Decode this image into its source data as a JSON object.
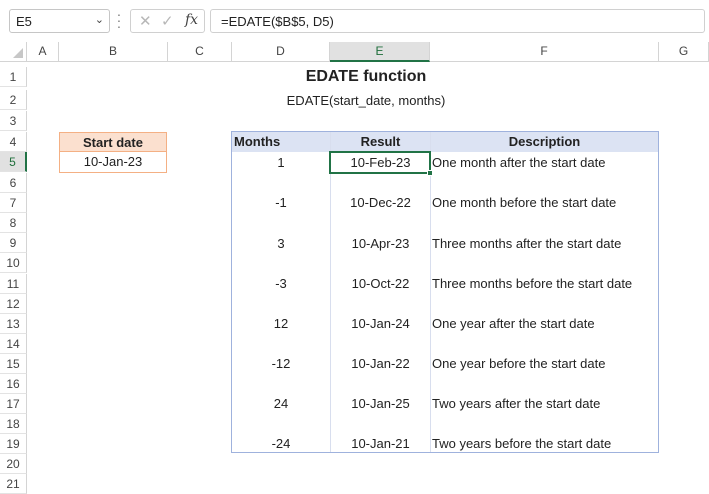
{
  "formula_bar": {
    "name_box": "E5",
    "formula": "=EDATE($B$5, D5)",
    "cancel_symbol": "✕",
    "enter_symbol": "✓",
    "fx_symbol": "fx"
  },
  "columns": [
    "A",
    "B",
    "C",
    "D",
    "E",
    "F",
    "G"
  ],
  "selected_column": "E",
  "rows": [
    "1",
    "2",
    "3",
    "4",
    "5",
    "6",
    "7",
    "8",
    "9",
    "10",
    "11",
    "12",
    "13",
    "14",
    "15",
    "16",
    "17",
    "18",
    "19",
    "20",
    "21"
  ],
  "selected_row": "5",
  "sheet": {
    "title": "EDATE function",
    "subtitle": "EDATE(start_date, months)",
    "start_date_label": "Start date",
    "start_date_value": "10-Jan-23",
    "table_headers": {
      "months": "Months",
      "result": "Result",
      "description": "Description"
    },
    "table_rows": [
      {
        "months": "1",
        "result": "10-Feb-23",
        "description": "One month after the start date"
      },
      {
        "months": "-1",
        "result": "10-Dec-22",
        "description": "One month before the start date"
      },
      {
        "months": "3",
        "result": "10-Apr-23",
        "description": "Three months after the start date"
      },
      {
        "months": "-3",
        "result": "10-Oct-22",
        "description": "Three months before the start date"
      },
      {
        "months": "12",
        "result": "10-Jan-24",
        "description": "One year after the start date"
      },
      {
        "months": "-12",
        "result": "10-Jan-22",
        "description": "One year before the start date"
      },
      {
        "months": "24",
        "result": "10-Jan-25",
        "description": "Two years after the start date"
      },
      {
        "months": "-24",
        "result": "10-Jan-21",
        "description": "Two years before the start date"
      }
    ]
  },
  "colors": {
    "accent_green": "#217346",
    "header_fill_orange": "#fbe0cf",
    "table_header_fill": "#dce3f3"
  }
}
